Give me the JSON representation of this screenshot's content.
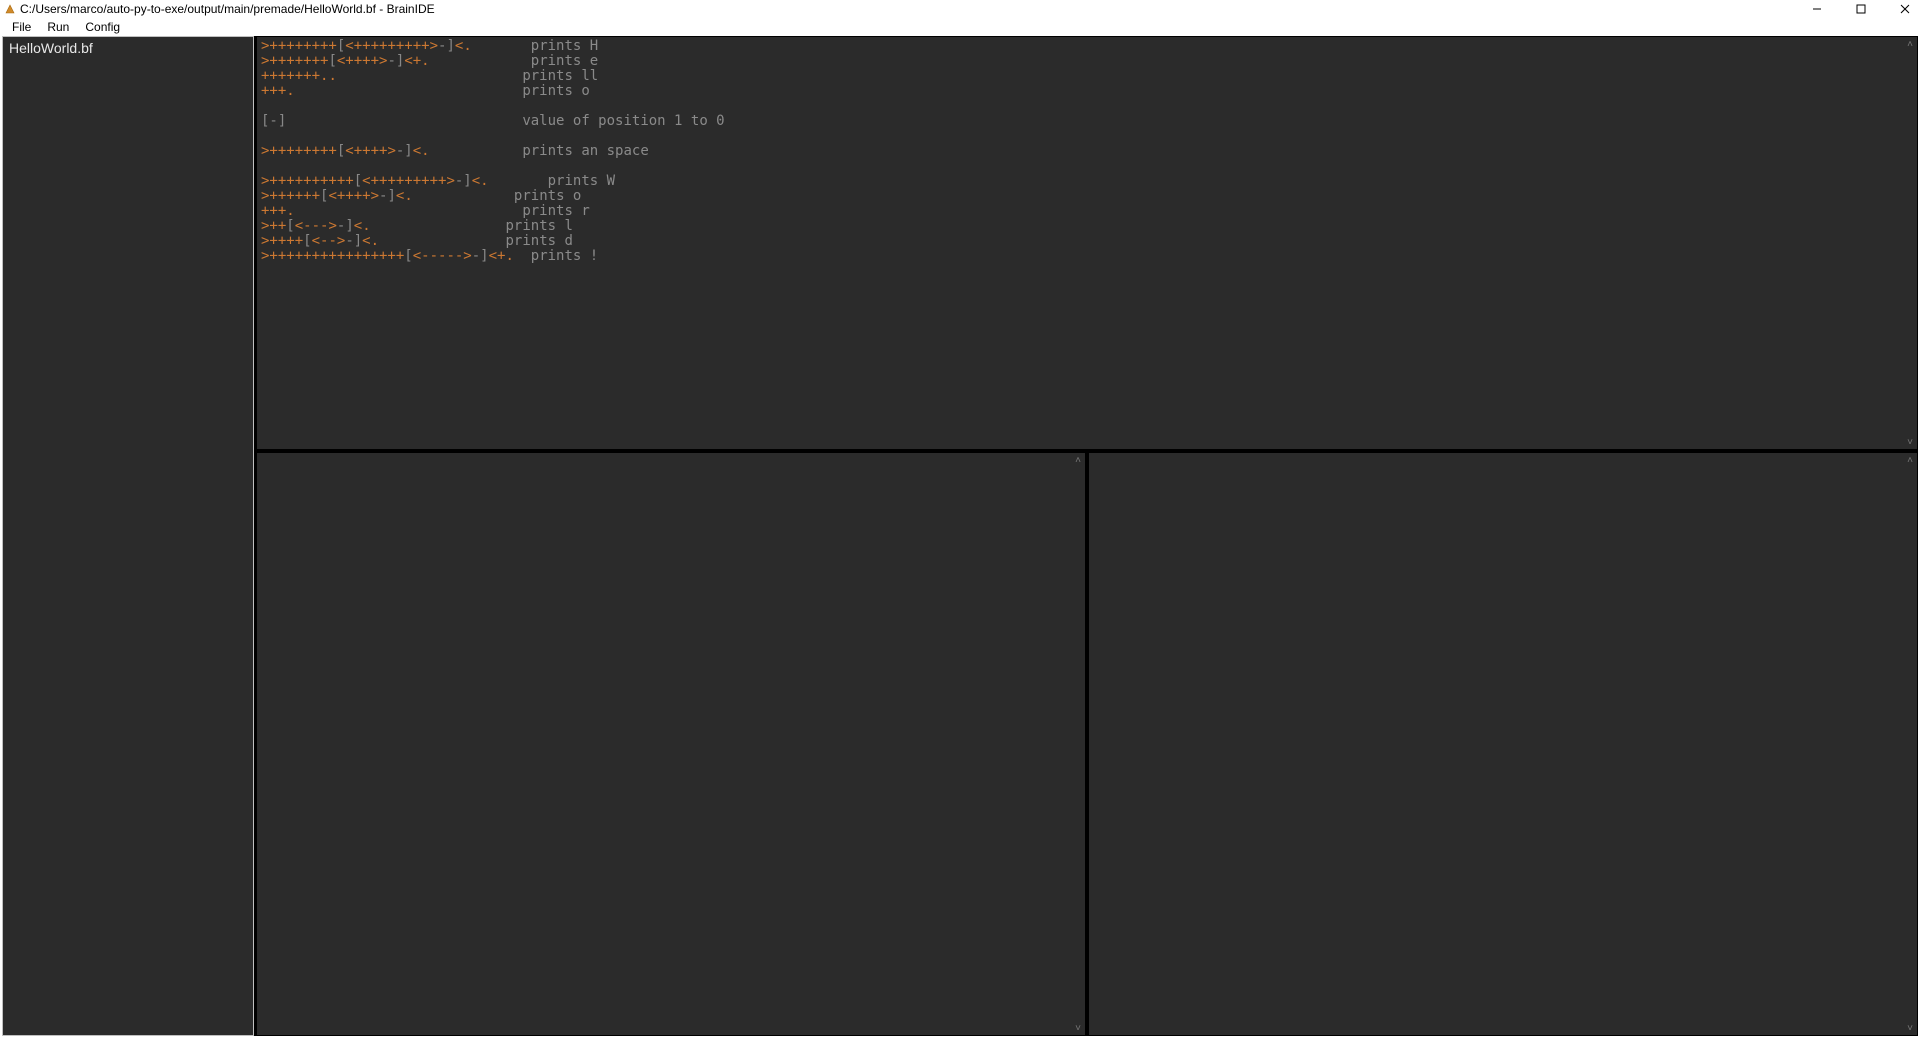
{
  "window": {
    "title": "C:/Users/marco/auto-py-to-exe/output/main/premade/HelloWorld.bf - BrainIDE"
  },
  "menu": {
    "file": "File",
    "run": "Run",
    "config": "Config"
  },
  "sidebar": {
    "items": [
      {
        "label": "HelloWorld.bf"
      }
    ]
  },
  "editor": {
    "lines": [
      {
        "code_op": ">++++++++",
        "code_br": "[",
        "code_op2": "<+++++++++>",
        "code_br2": "-]",
        "code_op3": "<",
        "code_dot": ".",
        "pad": "       ",
        "comment": "prints H"
      },
      {
        "code_op": ">+++++++",
        "code_br": "[",
        "code_op2": "<++++>",
        "code_br2": "-]",
        "code_op3": "<",
        "code_dot": "+.",
        "pad": "            ",
        "comment": "prints e"
      },
      {
        "code_op": "+++++++",
        "code_br": "",
        "code_op2": "",
        "code_br2": "",
        "code_op3": "",
        "code_dot": "..",
        "pad": "                      ",
        "comment": "prints ll"
      },
      {
        "code_op": "+++",
        "code_br": "",
        "code_op2": "",
        "code_br2": "",
        "code_op3": "",
        "code_dot": ".",
        "pad": "                           ",
        "comment": "prints o"
      },
      {
        "blank": true
      },
      {
        "code_br_full": "[-]",
        "pad": "                            ",
        "comment": "value of position 1 to 0"
      },
      {
        "blank": true
      },
      {
        "code_op": ">++++++++",
        "code_br": "[",
        "code_op2": "<++++>",
        "code_br2": "-]",
        "code_op3": "<",
        "code_dot": ".",
        "pad": "           ",
        "comment": "prints an space"
      },
      {
        "blank": true
      },
      {
        "code_op": ">++++++++++",
        "code_br": "[",
        "code_op2": "<+++++++++>",
        "code_br2": "-]",
        "code_op3": "<",
        "code_dot": ".",
        "pad": "       ",
        "comment": "prints W"
      },
      {
        "code_op": ">++++++",
        "code_br": "[",
        "code_op2": "<++++>",
        "code_br2": "-]",
        "code_op3": "<",
        "code_dot": ".",
        "pad": "            ",
        "comment": "prints o"
      },
      {
        "code_op": "+++",
        "code_br": "",
        "code_op2": "",
        "code_br2": "",
        "code_op3": "",
        "code_dot": ".",
        "pad": "                           ",
        "comment": "prints r"
      },
      {
        "code_op": ">++",
        "code_br": "[",
        "code_op2": "<--->",
        "code_br2": "-]",
        "code_op3": "<",
        "code_dot": ".",
        "pad": "                ",
        "comment": "prints l"
      },
      {
        "code_op": ">++++",
        "code_br": "[",
        "code_op2": "<-->",
        "code_br2": "-]",
        "code_op3": "<",
        "code_dot": ".",
        "pad": "               ",
        "comment": "prints d"
      },
      {
        "code_op": ">++++++++++++++++",
        "code_br": "[",
        "code_op2": "<----->",
        "code_br2": "-]",
        "code_op3": "<",
        "code_dot": "+.",
        "pad": "  ",
        "comment": "prints !"
      }
    ]
  }
}
